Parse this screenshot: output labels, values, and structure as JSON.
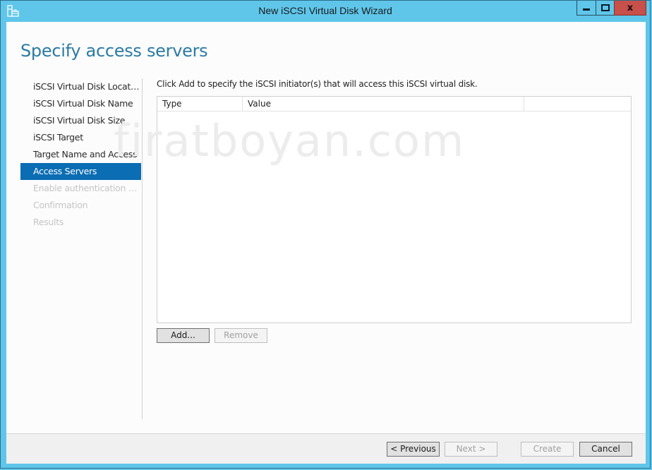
{
  "window": {
    "title": "New iSCSI Virtual Disk Wizard",
    "icon": "server-toolbox-icon",
    "controls": {
      "minimize": "minimize-icon",
      "maximize": "maximize-icon",
      "close": "close-icon",
      "close_glyph": "x"
    }
  },
  "page": {
    "title": "Specify access servers",
    "watermark": "firatboyan.com"
  },
  "nav": {
    "items": [
      {
        "label": "iSCSI Virtual Disk Location",
        "state": "normal"
      },
      {
        "label": "iSCSI Virtual Disk Name",
        "state": "normal"
      },
      {
        "label": "iSCSI Virtual Disk Size",
        "state": "normal"
      },
      {
        "label": "iSCSI Target",
        "state": "normal"
      },
      {
        "label": "Target Name and Access",
        "state": "normal"
      },
      {
        "label": "Access Servers",
        "state": "active"
      },
      {
        "label": "Enable authentication ser...",
        "state": "disabled"
      },
      {
        "label": "Confirmation",
        "state": "disabled"
      },
      {
        "label": "Results",
        "state": "disabled"
      }
    ]
  },
  "main": {
    "instruction": "Click Add to specify the iSCSI initiator(s) that will access this iSCSI virtual disk.",
    "table": {
      "columns": [
        "Type",
        "Value",
        ""
      ],
      "rows": []
    },
    "add_label": "Add...",
    "remove_label": "Remove"
  },
  "footer": {
    "previous_label": "< Previous",
    "next_label": "Next >",
    "create_label": "Create",
    "cancel_label": "Cancel"
  },
  "colors": {
    "titlebar": "#5fc6ea",
    "accent": "#0b6db3",
    "page_title": "#2b7ba3",
    "close_button": "#c7504a"
  }
}
